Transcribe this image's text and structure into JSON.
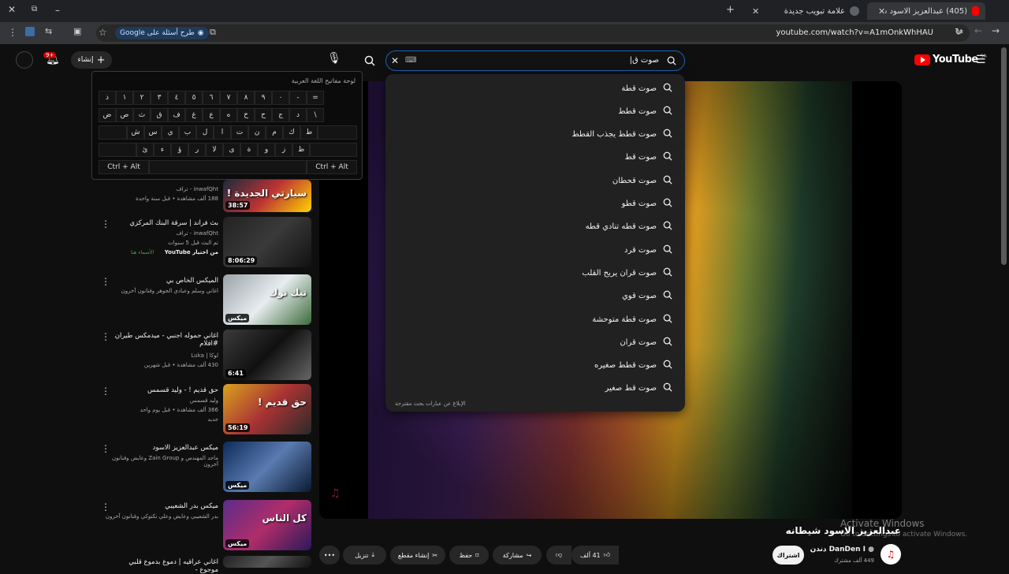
{
  "browser": {
    "tabs": [
      {
        "title": "(405) عبدالعزيز الاسود شيطانه -",
        "active": true
      },
      {
        "title": "علامة تبويب جديدة",
        "active": false
      }
    ],
    "url": "youtube.com/watch?v=A1mOnkWhHAU",
    "google_pill": "طرح أسئلة على Google"
  },
  "header": {
    "search_value": "صوت ق|",
    "create_label": "إنشاء",
    "notification_count": "9+",
    "logo_text": "YouTube",
    "logo_region": "SA"
  },
  "suggestions": [
    "صوت قطة",
    "صوت قطط",
    "صوت قطط يجذب القطط",
    "صوت قط",
    "صوت قحطان",
    "صوت قطو",
    "صوت قطه تنادي قطه",
    "صوت قرد",
    "صوت قران يريح القلب",
    "صوت قوي",
    "صوت قطة متوحشة",
    "صوت قران",
    "صوت قطط صغيره",
    "صوت قط صغير"
  ],
  "suggestions_report": "الإبلاغ عن عبارات بحث مقترحة",
  "keyboard": {
    "title": "لوحة مفاتيح اللغة العربية",
    "row1": [
      "ذ",
      "١",
      "٢",
      "٣",
      "٤",
      "٥",
      "٦",
      "٧",
      "٨",
      "٩",
      "٠",
      "-",
      "="
    ],
    "row2": [
      "ض",
      "ص",
      "ث",
      "ق",
      "ف",
      "غ",
      "ع",
      "ه",
      "خ",
      "ح",
      "ج",
      "د",
      "\\"
    ],
    "row3": [
      "ش",
      "س",
      "ي",
      "ب",
      "ل",
      "ا",
      "ت",
      "ن",
      "م",
      "ك",
      "ط"
    ],
    "row4": [
      "ئ",
      "ء",
      "ؤ",
      "ر",
      "لا",
      "ى",
      "ة",
      "و",
      "ز",
      "ظ"
    ],
    "ctrl_alt": "Ctrl + Alt"
  },
  "related": [
    {
      "title": "",
      "channel": "inwafQht - تراف",
      "meta": "188 ألف مشاهدة • قبل سنة واحدة",
      "duration": "38:57",
      "thumb_text": "سيارتي الجديدة !"
    },
    {
      "title": "بث فراند | سرقة البنك المركزي",
      "channel": "inwafQht - تراف",
      "meta": "تم البث قبل 5 سنوات",
      "badge": "من اختيار YouTube",
      "badge2": "الأسماء هنا",
      "duration": "8:06:29",
      "thumb_text": ""
    },
    {
      "title": "الميكس الخاص بي",
      "channel": "",
      "meta": "اغاني وسلم وعبادي الجوهر وفنانون آخرون",
      "duration": "ميكس",
      "thumb_text": "تيك توك"
    },
    {
      "title": "اغاني حموله اجنبي - ميدمكس طيران #افلام",
      "channel": "لوكا | Luka",
      "meta": "430 ألف مشاهدة • قبل شهرين",
      "duration": "6:41",
      "thumb_text": ""
    },
    {
      "title": "حق قديم ! - وليد قسمس",
      "channel": "وليد قسمس",
      "meta": "366 ألف مشاهدة • قبل يوم واحد",
      "meta2": "جديد",
      "duration": "56:19",
      "thumb_text": "حق قديم !"
    },
    {
      "title": "ميكس عبدالعزيز الاسود",
      "channel": "",
      "meta": "ماجد المهندس و Zain Group وعايض وفنانون آخرون",
      "duration": "ميكس",
      "thumb_text": ""
    },
    {
      "title": "ميكس بدر الشعيبي",
      "channel": "",
      "meta": "بدر الشعيبي وعايض وعلي نكتوكي وفنانون آخرون",
      "duration": "ميكس",
      "thumb_text": "كل الناس"
    },
    {
      "title": "اغاني عراقيه | دموع بدموع قلبي موجوع -",
      "channel": "",
      "meta": "",
      "duration": "",
      "thumb_text": ""
    }
  ],
  "video": {
    "title": "عبدالعزيز الاسود شيطانه",
    "channel_name": "DanDen I دندن",
    "subscribers": "449 ألف مشترك",
    "join_label": "اشتراك",
    "like_count": "41 ألف",
    "share_label": "مشاركة",
    "save_label": "حفظ",
    "clip_label": "إنشاء مقطع",
    "download_label": "تنزيل"
  },
  "watermark": {
    "line1": "Activate Windows",
    "line2": "Go to Settings to activate Windows."
  },
  "colors": {
    "background": "#0f0f0f",
    "accent_blue": "#1c62b9",
    "youtube_red": "#ff0000"
  }
}
